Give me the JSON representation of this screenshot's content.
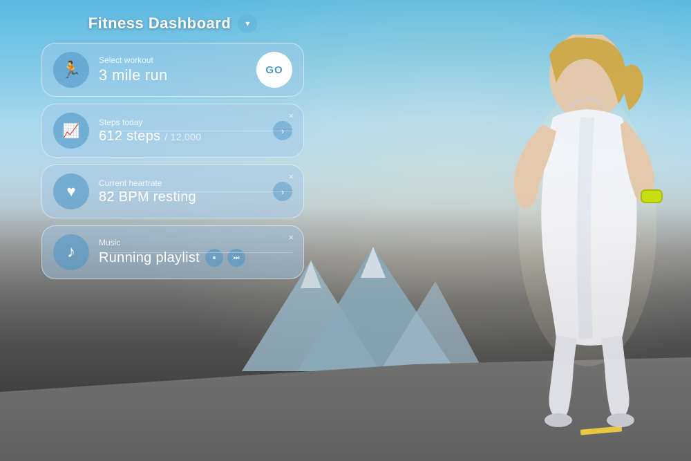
{
  "header": {
    "title": "Fitness Dashboard",
    "dropdown_label": "▾"
  },
  "workout_card": {
    "label": "Select workout",
    "value": "3 mile run",
    "go_label": "GO",
    "icon": "🏃"
  },
  "steps_card": {
    "label": "Steps today",
    "value": "612 steps",
    "sub_value": "/ 12,000",
    "icon": "📈",
    "close": "×"
  },
  "heartrate_card": {
    "label": "Current heartrate",
    "value": "82 BPM resting",
    "icon": "♥",
    "close": "×"
  },
  "music_card": {
    "label": "Music",
    "value": "Running playlist",
    "icon": "♪",
    "close": "×",
    "pause_label": "⏸",
    "skip_label": "⏭"
  }
}
